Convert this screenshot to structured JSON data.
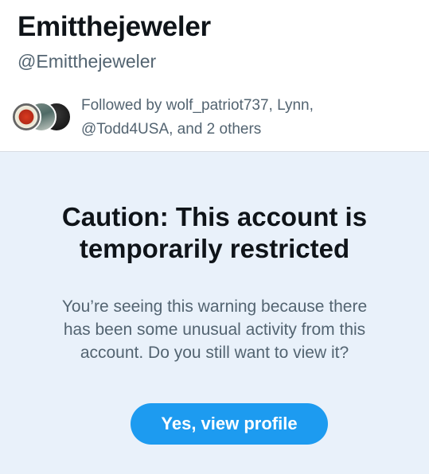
{
  "profile": {
    "display_name": "Emitthejeweler",
    "handle": "@Emitthejeweler",
    "followed_by_line1": "Followed by wolf_patriot737, Lynn,",
    "followed_by_line2": "@Todd4USA, and 2 others"
  },
  "warning": {
    "title_line1": "Caution: This account is",
    "title_line2": "temporarily restricted",
    "body_line1": "You’re seeing this warning because there",
    "body_line2": "has been some unusual activity from this",
    "body_line3": "account. Do you still want to view it?",
    "button_label": "Yes, view profile"
  },
  "colors": {
    "accent": "#1d9bf0",
    "panel_background": "#e9f1fa",
    "secondary_text": "#536471",
    "primary_text": "#0f1419"
  }
}
